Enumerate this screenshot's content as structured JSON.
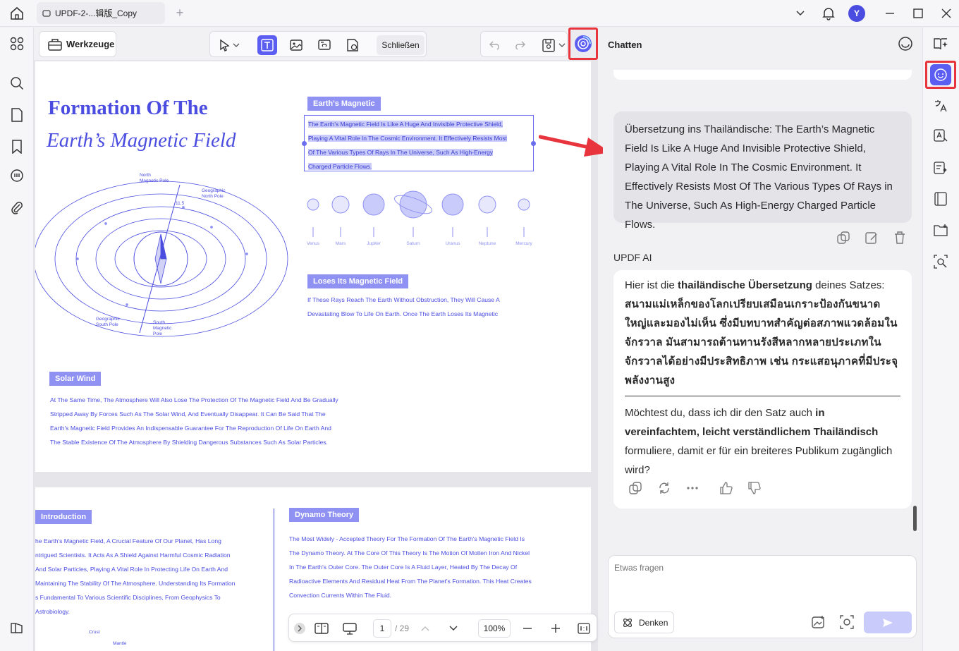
{
  "titlebar": {
    "tab_title": "UPDF-2-...辑版_Copy",
    "avatar_initial": "Y"
  },
  "toolbar": {
    "tools_label": "Werkzeuge",
    "close_label": "Schließen"
  },
  "document": {
    "title_line1": "Formation Of The",
    "title_line2": "Earth’s Magnetic Field",
    "badge_magnetic": "Earth's Magnetic",
    "selected_lines": [
      "The Earth's Magnetic Field Is Like A Huge And Invisible Protective Shield,",
      "Playing A Vital Role In The Cosmic Environment. It Effectively Resists Most",
      "Of The Various Types Of Rays In The Universe, Such As High-Energy",
      "Charged Particle Flows."
    ],
    "diagram_labels": {
      "north_magnetic": "North\nMagnetic Pole",
      "geo_north": "Geographic\nNorth Pole",
      "angle": "11.5",
      "geo_south": "Geographic\nSouth Pole",
      "south_magnetic": "South\nMagnetic\nPole"
    },
    "planets": [
      "Venus",
      "Mars",
      "Jupiter",
      "Saturn",
      "Uranus",
      "Neptune",
      "Mercury"
    ],
    "badge_loses": "Loses Its Magnetic Field",
    "loses_lines": [
      "If These Rays Reach The Earth Without Obstruction, They Will Cause A",
      "Devastating Blow To Life On Earth. Once The Earth Loses Its Magnetic"
    ],
    "badge_solar": "Solar Wind",
    "solar_lines": [
      "At The Same Time, The Atmosphere Will Also Lose The Protection Of The Magnetic Field And Be Gradually",
      "Stripped Away By Forces Such As The Solar Wind, And Eventually Disappear. It Can Be Said That The",
      "Earth's Magnetic Field Provides An Indispensable Guarantee For The Reproduction Of Life On Earth And",
      "The Stable Existence Of The Atmosphere By Shielding Dangerous Substances Such As Solar Particles."
    ],
    "badge_intro": "Introduction",
    "intro_lines": [
      "he Earth's Magnetic Field, A Crucial Feature Of Our Planet, Has Long",
      "ntrigued Scientists. It Acts As A Shield Against Harmful Cosmic Radiation",
      "And Solar Particles, Playing A Vital Role In Protecting Life On Earth And",
      "Maintaining The Stability Of The Atmosphere. Understanding Its Formation",
      "s Fundamental To Various Scientific Disciplines, From Geophysics To",
      "Astrobiology."
    ],
    "badge_dynamo": "Dynamo Theory",
    "dynamo_lines": [
      "The Most Widely - Accepted Theory For The Formation Of The Earth's Magnetic Field Is",
      "The Dynamo Theory. At The Core Of This Theory Is The Motion Of Molten Iron And Nickel",
      "In The Earth's Outer Core. The Outer Core Is A Fluid Layer, Heated By The Decay Of",
      "Radioactive Elements And Residual Heat From The Planet's Formation. This Heat Creates",
      "Convection Currents Within The Fluid."
    ],
    "crust_label": "Crust",
    "mantle_label": "Mantle"
  },
  "pager": {
    "current_page": "1",
    "total": "/ 29",
    "zoom": "100%"
  },
  "chat": {
    "title": "Chatten",
    "user_message": "Übersetzung ins Thailändische: The Earth’s Magnetic Field Is Like A Huge And Invisible Protective Shield, Playing A Vital Role In The Cosmic Environment. It Effectively Resists Most Of The Various Types Of Rays in The Universe, Such As High-Energy Charged Particle Flows.",
    "ai_name": "UPDF AI",
    "ai_intro_pre": "Hier ist die ",
    "ai_intro_bold": "thailändische Übersetzung",
    "ai_intro_post": " deines Satzes:",
    "ai_thai": "สนามแม่เหล็กของโลกเปรียบเสมือนเกราะป้องกันขนาดใหญ่และมองไม่เห็น ซึ่งมีบทบาทสำคัญต่อสภาพแวดล้อมในจักรวาล มันสามารถต้านทานรังสีหลากหลายประเภทในจักรวาลได้อย่างมีประสิทธิภาพ เช่น กระแสอนุภาคที่มีประจุพลังงานสูง",
    "ai_follow_pre": "Möchtest du, dass ich dir den Satz auch ",
    "ai_follow_bold": "in vereinfachtem, leicht verständlichem Thailändisch",
    "ai_follow_post": " formuliere, damit er für ein breiteres Publikum zugänglich wird?",
    "input_placeholder": "Etwas fragen",
    "think_label": "Denken"
  },
  "colors": {
    "accent": "#5b5ef0",
    "doc_blue": "#4b4de0",
    "highlight_red": "#e8343c"
  }
}
